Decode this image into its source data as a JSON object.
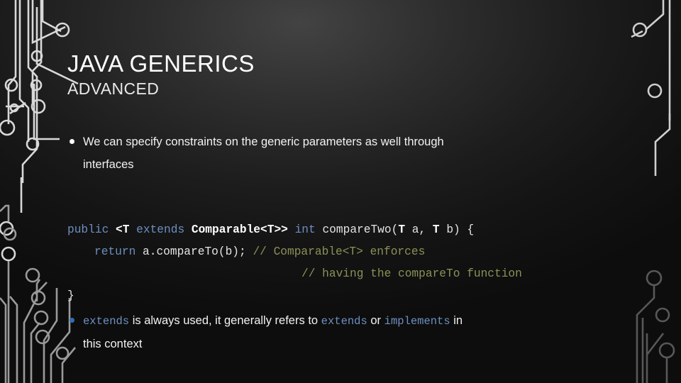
{
  "slide": {
    "title": "JAVA GENERICS",
    "subtitle": "ADVANCED",
    "background_top_color": "#434343",
    "background_bottom_color": "#0d0d0d",
    "text_color": "#f2f2f2"
  },
  "bullets": [
    {
      "marker": "round-bullet",
      "marker_color": "#ffffff",
      "line1_a": "We can specify constraints on the generic parameters as well through",
      "line2": "interfaces"
    },
    {
      "marker": "round-bullet",
      "marker_color": "#2f6fb5",
      "code_a": "extends",
      "text_a": " is always used, it generally refers to ",
      "code_b": "extends",
      "text_b": " or ",
      "code_c": "implements",
      "text_c": " in",
      "line2": "this context"
    }
  ],
  "code_block": {
    "keyword_color": "#6d8fc0",
    "type_color": "#ffffff",
    "comment_color": "#8c9157",
    "plain_color": "#e4e4e4",
    "line1": {
      "kw_public": "public",
      "generic_open": " <T ",
      "kw_extends": "extends",
      "generic_bound": " Comparable<T>> ",
      "kw_int": "int",
      "signature": " compareTwo(",
      "param_t1": "T",
      "param_a": " a, ",
      "param_t2": "T",
      "param_b": " b) {"
    },
    "line2": {
      "kw_return": "return",
      "body": " a.compareTo(b); ",
      "comment": "// Comparable<T> enforces"
    },
    "line3": {
      "comment": "// having the compareTo function"
    },
    "line4": {
      "close_brace": "}"
    }
  },
  "decoration": {
    "name": "circuit-board-traces",
    "trace_color_bright": "#d8d8d8",
    "trace_color_dim": "#6f6f6f"
  }
}
